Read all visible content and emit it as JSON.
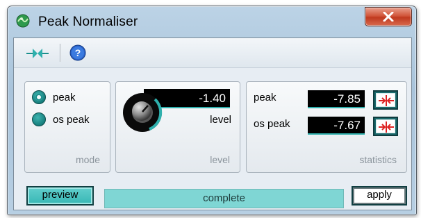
{
  "window": {
    "title": "Peak Normaliser"
  },
  "icons": {
    "app": "plugin-logo-icon",
    "close": "close-icon",
    "toolbar_bypass": "bypass-icon",
    "toolbar_help": "help-icon",
    "peak_button": "peak-to-level-icon",
    "help_glyph": "?"
  },
  "mode": {
    "label": "mode",
    "options": [
      {
        "label": "peak",
        "selected": true
      },
      {
        "label": "os peak",
        "selected": false
      }
    ]
  },
  "level": {
    "panel_label": "level",
    "readout": "-1.40",
    "knob_label": "level"
  },
  "statistics": {
    "panel_label": "statistics",
    "peak_label": "peak",
    "peak_value": "-7.85",
    "os_peak_label": "os peak",
    "os_peak_value": "-7.67"
  },
  "footer": {
    "preview_label": "preview",
    "progress_text": "complete",
    "progress_fraction": 1.0,
    "apply_label": "apply"
  },
  "colors": {
    "accent": "#2fb0ad",
    "close_red": "#c8452a",
    "lcd_bg": "#000000"
  }
}
